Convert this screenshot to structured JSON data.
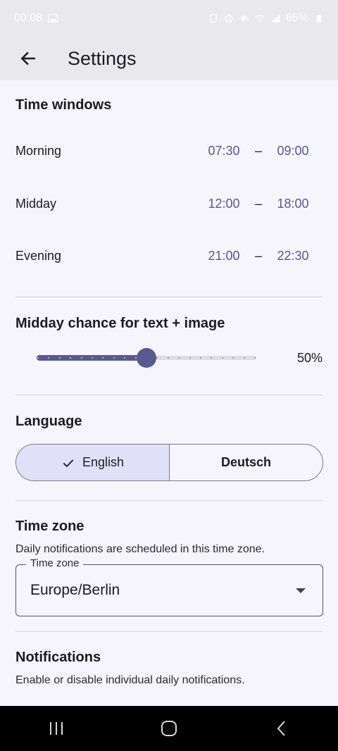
{
  "status_bar": {
    "time": "00:08",
    "battery": "65%"
  },
  "app_bar": {
    "title": "Settings"
  },
  "time_windows": {
    "title": "Time windows",
    "rows": [
      {
        "label": "Morning",
        "start": "07:30",
        "end": "09:00"
      },
      {
        "label": "Midday",
        "start": "12:00",
        "end": "18:00"
      },
      {
        "label": "Evening",
        "start": "21:00",
        "end": "22:30"
      }
    ],
    "separator": "–"
  },
  "midday_chance": {
    "title": "Midday chance for text + image",
    "value": 0.5,
    "value_label": "50%"
  },
  "language": {
    "title": "Language",
    "options": [
      {
        "label": "English",
        "selected": true
      },
      {
        "label": "Deutsch",
        "selected": false
      }
    ]
  },
  "time_zone": {
    "title": "Time zone",
    "description": "Daily notifications are scheduled in this time zone.",
    "field_label": "Time zone",
    "value": "Europe/Berlin"
  },
  "notifications": {
    "title": "Notifications",
    "description": "Enable or disable individual daily notifications."
  },
  "colors": {
    "accent": "#585990",
    "selected_segment": "#e2e0f9",
    "background": "#f6f5fb"
  },
  "icons": {
    "back": "arrow-left-icon",
    "check": "check-icon",
    "dropdown": "caret-down-icon",
    "nav_recents": "recents-icon",
    "nav_home": "home-icon",
    "nav_back": "chevron-left-icon"
  }
}
